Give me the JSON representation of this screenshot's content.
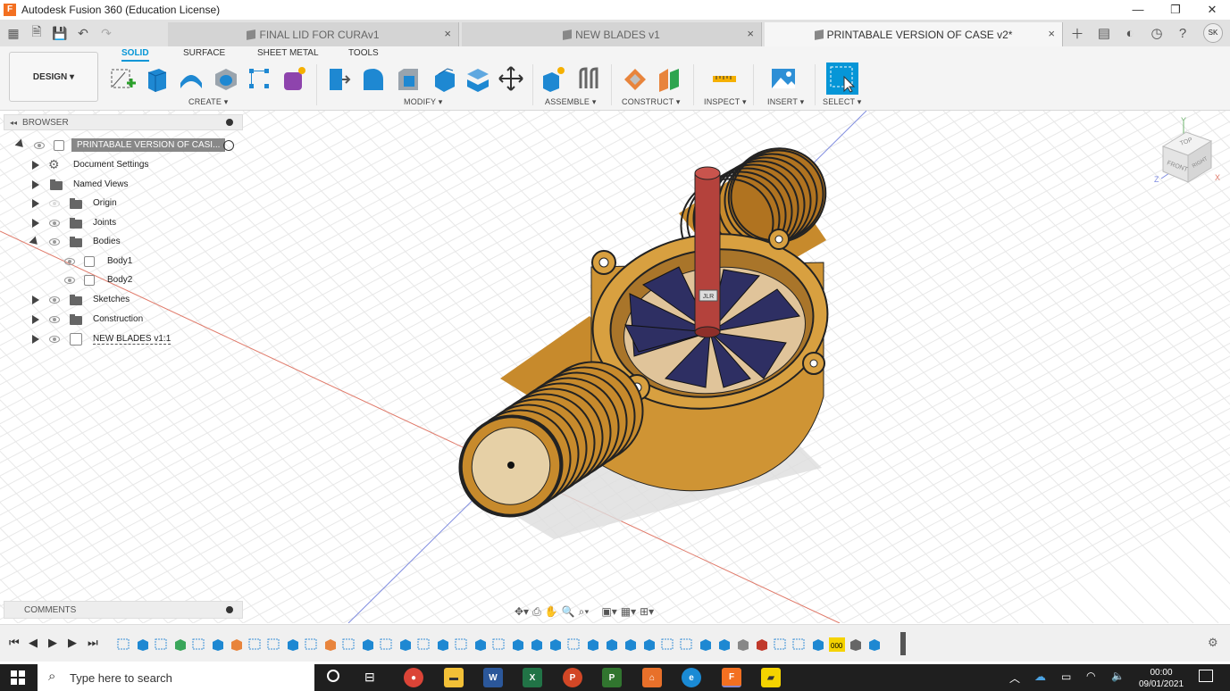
{
  "app": {
    "title": "Autodesk Fusion 360 (Education License)",
    "icon_letter": "F"
  },
  "window_controls": {
    "minimize": "—",
    "restore": "❐",
    "close": "✕"
  },
  "tabs": [
    {
      "label": "FINAL LID FOR CURAv1",
      "active": false
    },
    {
      "label": "NEW BLADES v1",
      "active": false
    },
    {
      "label": "PRINTABALE VERSION OF CASE v2*",
      "active": true
    }
  ],
  "tab_close": "×",
  "user_initials": "SK",
  "toolbar": {
    "design_label": "DESIGN ▾",
    "tabs": [
      "SOLID",
      "SURFACE",
      "SHEET METAL",
      "TOOLS"
    ],
    "active_tab": "SOLID",
    "groups": [
      "CREATE ▾",
      "MODIFY ▾",
      "ASSEMBLE ▾",
      "CONSTRUCT ▾",
      "INSPECT ▾",
      "INSERT ▾",
      "SELECT ▾"
    ]
  },
  "browser": {
    "header": "BROWSER",
    "root": "PRINTABALE VERSION OF CASI...",
    "nodes": [
      "Document Settings",
      "Named Views",
      "Origin",
      "Joints",
      "Bodies",
      "Body1",
      "Body2",
      "Sketches",
      "Construction",
      "NEW BLADES v1:1"
    ]
  },
  "comments": {
    "label": "COMMENTS"
  },
  "viewcube": {
    "top": "TOP",
    "front": "FRONT",
    "right": "RIGHT",
    "axis_x": "X",
    "axis_y": "Y",
    "axis_z": "Z"
  },
  "model": {
    "label": "JLR"
  },
  "taskbar": {
    "search_placeholder": "Type here to search",
    "time": "00:00",
    "date": "09/01/2021"
  },
  "colors": {
    "accent": "#0696d7",
    "case": "#d39a3a",
    "shaft": "#b4423c",
    "blades": "#2e2f63"
  }
}
